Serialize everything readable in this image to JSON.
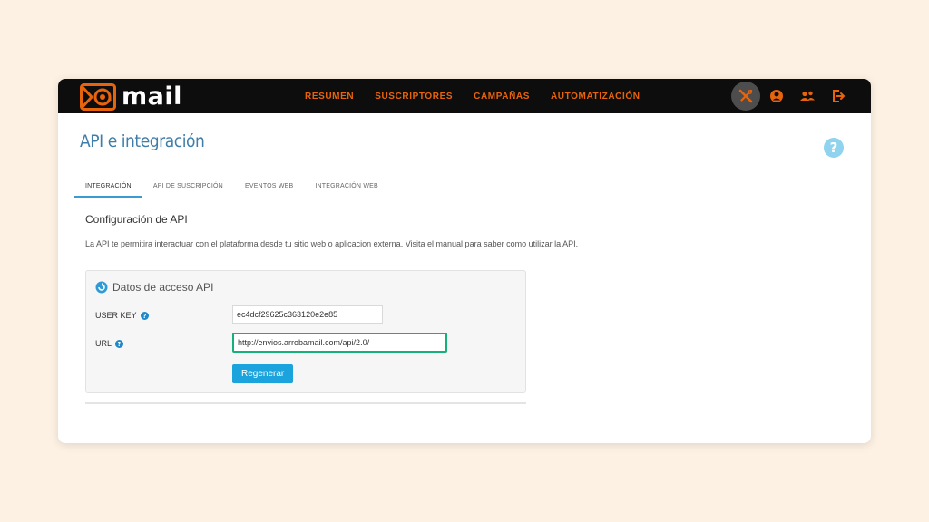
{
  "brand": {
    "name": "mail",
    "accent": "#e8640c",
    "topbar_bg": "#0d0d0d",
    "title_color": "#3f7ea8",
    "button_color": "#1ba3dd",
    "highlight_color": "#16b07a"
  },
  "nav": {
    "items": [
      "RESUMEN",
      "SUSCRIPTORES",
      "CAMPAÑAS",
      "AUTOMATIZACIÓN"
    ]
  },
  "top_icons": [
    "tools-icon",
    "user-icon",
    "users-icon",
    "logout-icon"
  ],
  "page": {
    "title": "API e integración"
  },
  "tabs": [
    {
      "label": "INTEGRACIÓN",
      "active": true
    },
    {
      "label": "API DE SUSCRIPCIÓN",
      "active": false
    },
    {
      "label": "EVENTOS WEB",
      "active": false
    },
    {
      "label": "INTEGRACIÓN WEB",
      "active": false
    }
  ],
  "section": {
    "title": "Configuración de API",
    "description": "La API te permitira interactuar con el plataforma desde tu sitio web o aplicacion externa. Visita el manual para saber como utilizar la API."
  },
  "panel": {
    "title": "Datos de acceso API",
    "user_key_label": "USER KEY",
    "user_key_value": "ec4dcf29625c363120e2e85",
    "url_label": "URL",
    "url_value": "http://envios.arrobamail.com/api/2.0/",
    "regen_label": "Regenerar"
  }
}
